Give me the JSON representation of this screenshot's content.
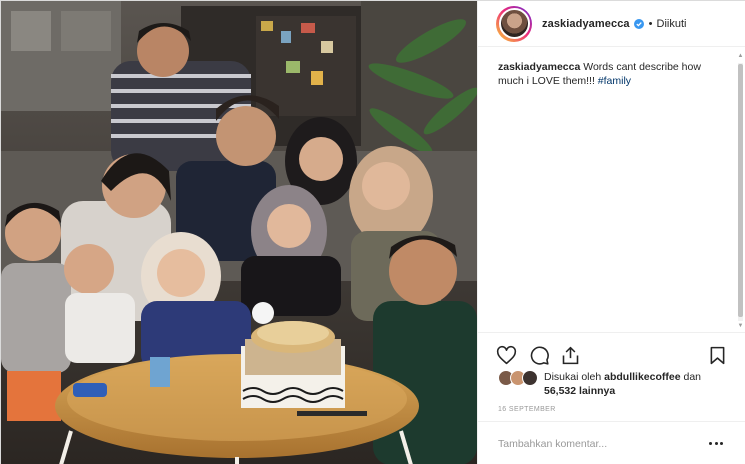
{
  "post": {
    "photo_alt": "family-photo"
  },
  "header": {
    "username": "zaskiadyamecca",
    "separator": "•",
    "follow_status": "Diikuti"
  },
  "caption": {
    "username": "zaskiadyamecca",
    "text": "Words cant describe how much i LOVE them!!!",
    "hashtag": "#family"
  },
  "actions": {
    "like_icon": "heart-icon",
    "comment_icon": "comment-icon",
    "share_icon": "share-icon",
    "save_icon": "bookmark-icon"
  },
  "likes": {
    "prefix": "Disukai oleh",
    "liker": "abdullikecoffee",
    "conjunction": "dan",
    "count": "56,532",
    "suffix": "lainnya"
  },
  "date": "16 SEPTEMBER",
  "comment_box": {
    "placeholder": "Tambahkan komentar...",
    "more_icon": "more-options-icon"
  },
  "colors": {
    "text": "#262626",
    "muted": "#999999",
    "link": "#003569",
    "verified": "#3897f0",
    "border": "#efefef"
  }
}
